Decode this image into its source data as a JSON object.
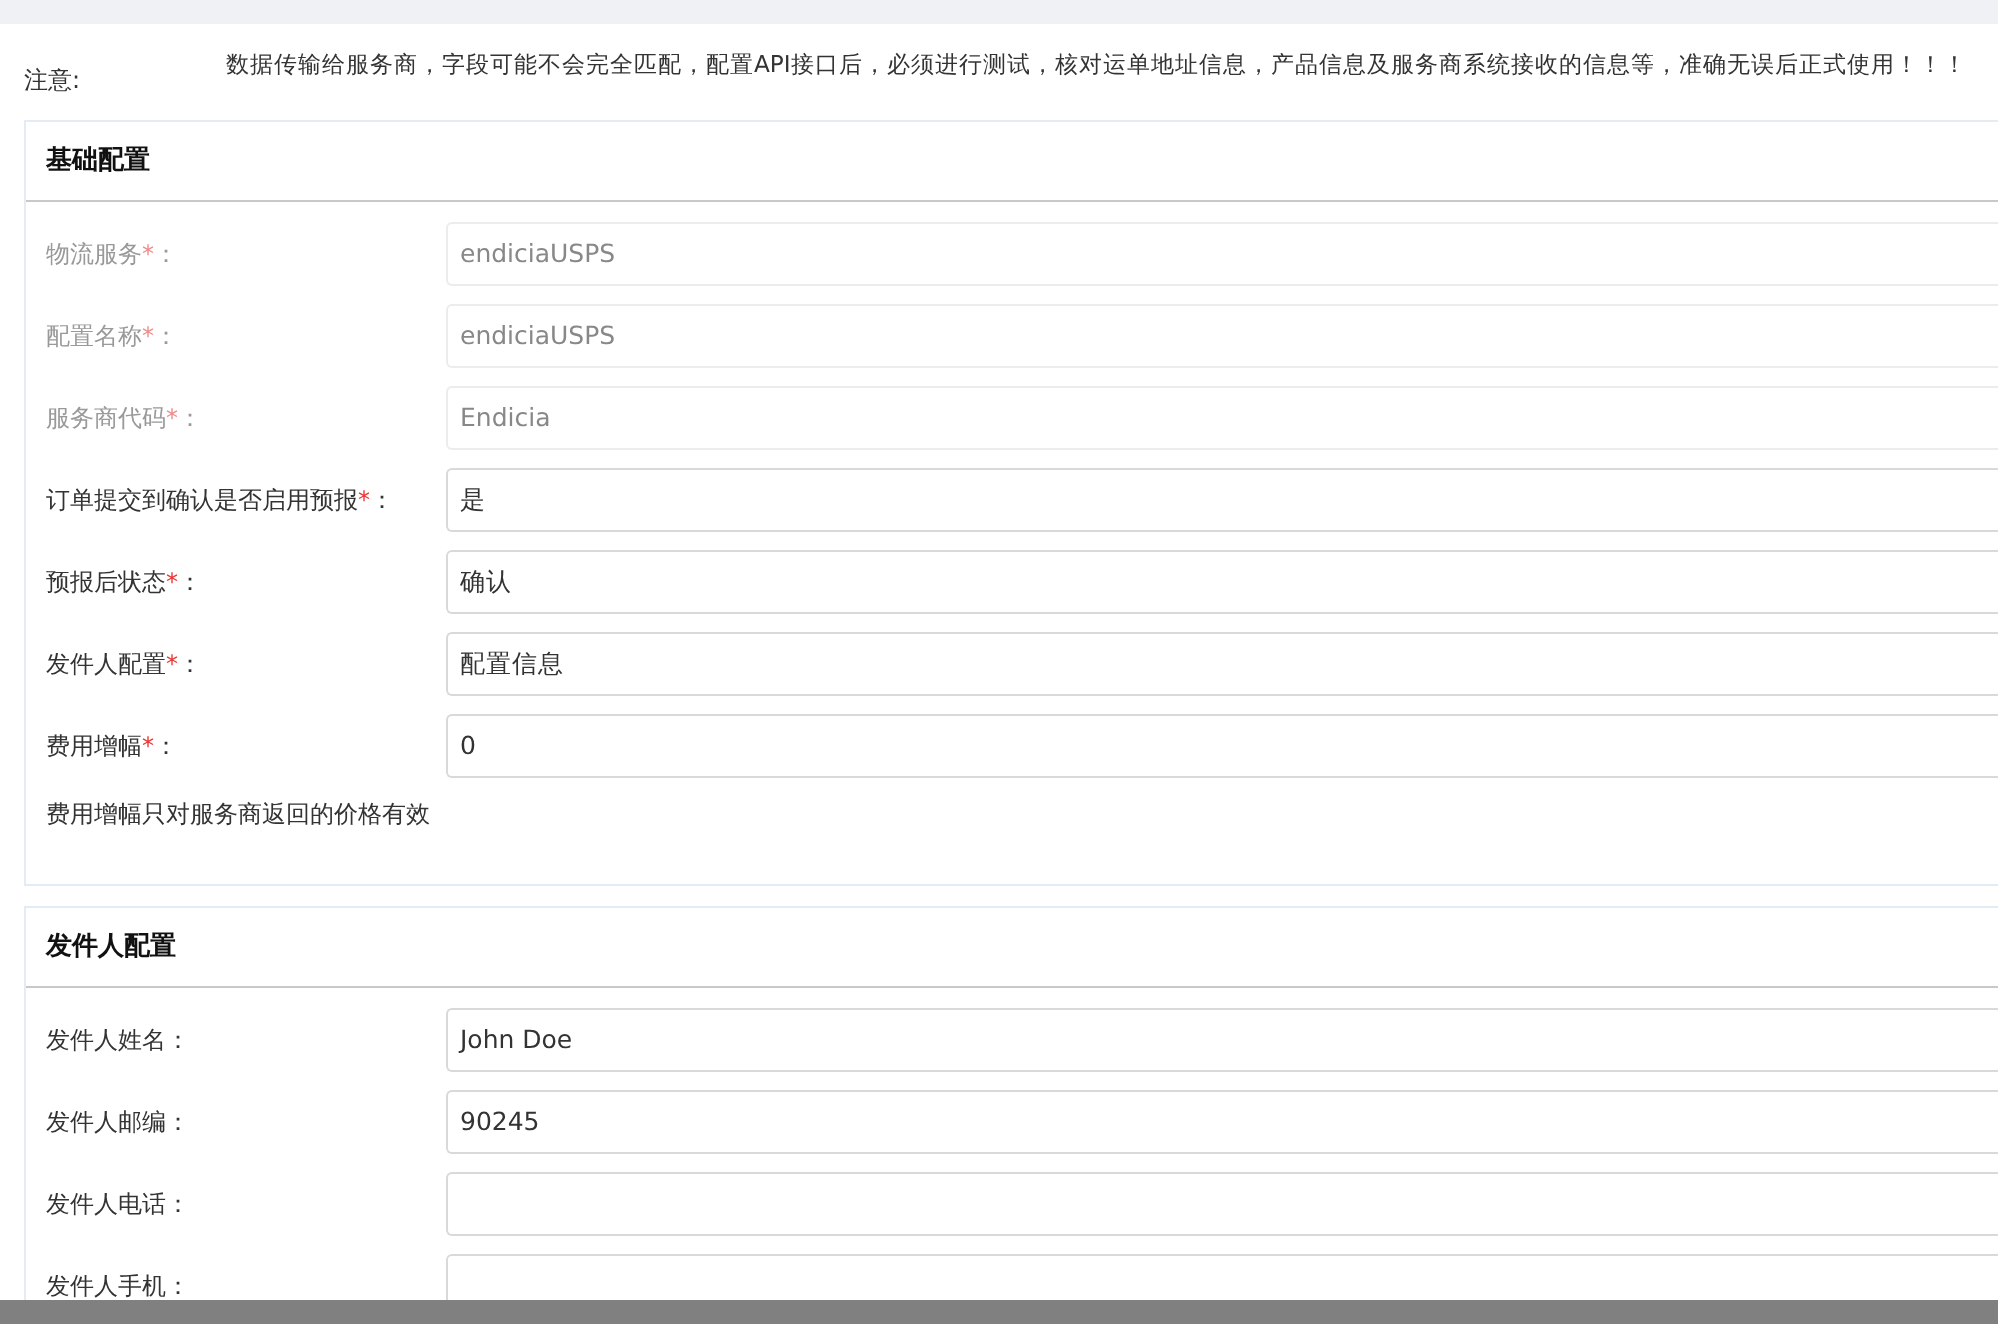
{
  "notice": {
    "label": "注意:",
    "text": "数据传输给服务商，字段可能不会完全匹配，配置API接口后，必须进行测试，核对运单地址信息，产品信息及服务商系统接收的信息等，准确无误后正式使用！！！"
  },
  "sections": [
    {
      "title": "基础配置",
      "fields": [
        {
          "label": "物流服务",
          "mark": "*",
          "colon": "：",
          "disabled": true,
          "value": "endiciaUSPS"
        },
        {
          "label": "配置名称",
          "mark": "*",
          "colon": "：",
          "disabled": true,
          "value": "endiciaUSPS"
        },
        {
          "label": "服务商代码",
          "mark": "*",
          "colon": "：",
          "disabled": true,
          "value": "Endicia"
        },
        {
          "label": "订单提交到确认是否启用预报",
          "mark": "*",
          "colon": "：",
          "disabled": false,
          "value": "是"
        },
        {
          "label": "预报后状态",
          "mark": "*",
          "colon": "：",
          "disabled": false,
          "value": "确认"
        },
        {
          "label": "发件人配置",
          "mark": "*",
          "colon": "：",
          "disabled": false,
          "value": "配置信息"
        },
        {
          "label": "费用增幅",
          "mark": "*",
          "colon": "：",
          "disabled": false,
          "value": "0"
        }
      ],
      "note": "费用增幅只对服务商返回的价格有效"
    },
    {
      "title": "发件人配置",
      "fields": [
        {
          "label": "发件人姓名",
          "colon": "：",
          "disabled": false,
          "value": "John Doe"
        },
        {
          "label": "发件人邮编",
          "colon": "：",
          "disabled": false,
          "value": "90245"
        },
        {
          "label": "发件人电话",
          "colon": "：",
          "disabled": false
        },
        {
          "label": "发件人手机",
          "colon": "：",
          "disabled": false
        }
      ]
    }
  ]
}
